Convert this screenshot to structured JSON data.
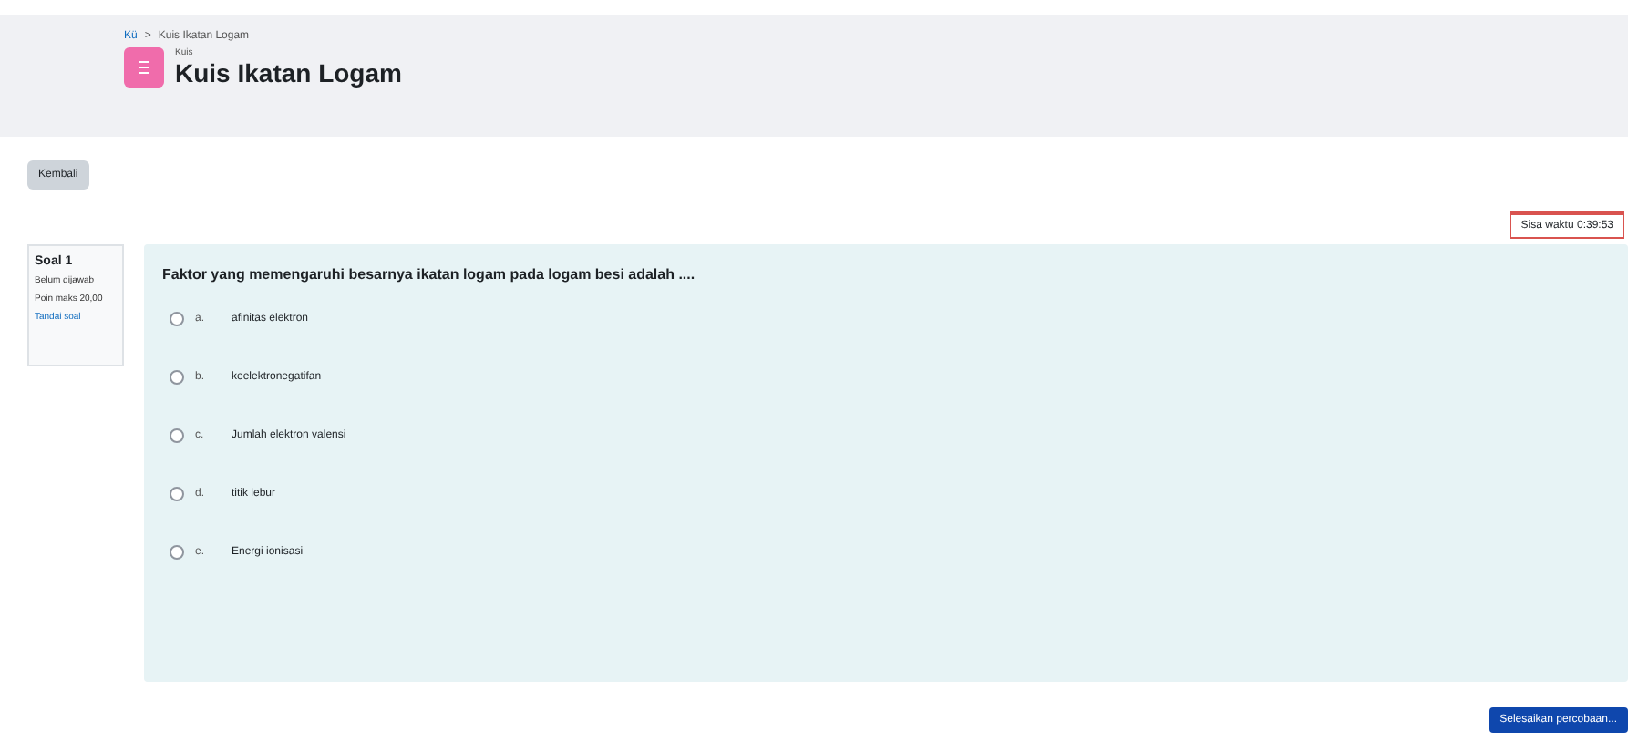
{
  "header": {
    "breadcrumb": [
      "Kü",
      "Kuis Ikatan Logam"
    ],
    "separator": ">",
    "module_label": "Kuis",
    "title": "Kuis Ikatan Logam"
  },
  "back_button": "Kembali",
  "timer": "Sisa waktu 0:39:53",
  "question_info": {
    "number": "Soal 1",
    "status": "Belum dijawab",
    "marks": "Poin maks 20,00",
    "flag": "Tandai soal"
  },
  "question": {
    "text": "Faktor yang memengaruhi besarnya ikatan logam pada logam besi adalah ....",
    "options": [
      {
        "letter": "a.",
        "text": "afinitas elektron",
        "selected": false
      },
      {
        "letter": "b.",
        "text": "keelektronegatifan",
        "selected": false
      },
      {
        "letter": "c.",
        "text": "Jumlah elektron valensi",
        "selected": false
      },
      {
        "letter": "d.",
        "text": "titik lebur",
        "selected": false
      },
      {
        "letter": "e.",
        "text": "Energi ionisasi",
        "selected": false
      }
    ]
  },
  "next_button": "Selesaikan percobaan..."
}
